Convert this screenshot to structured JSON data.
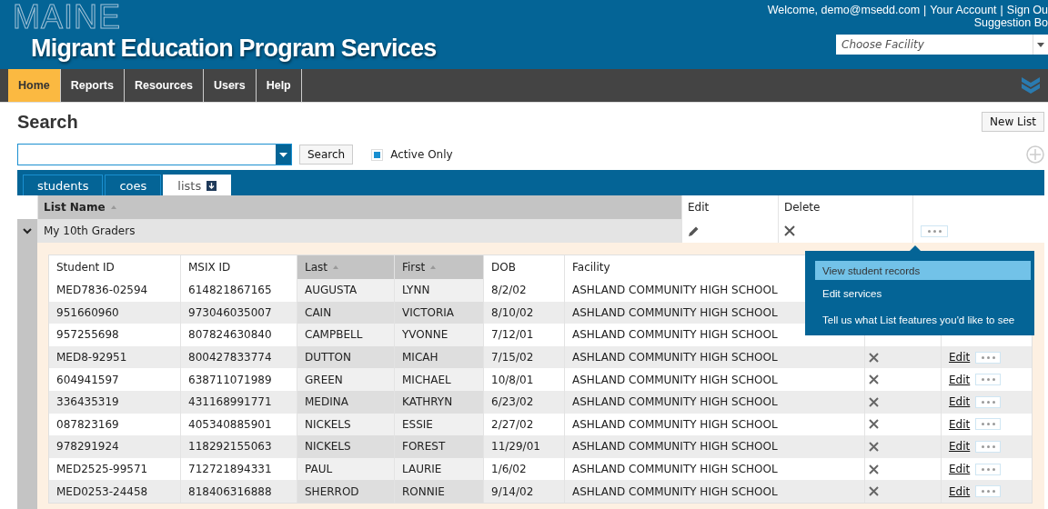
{
  "header": {
    "logo_outline": "MAINE",
    "logo_title": "Migrant Education Program Services",
    "welcome": "Welcome, demo@msedd.com",
    "links": [
      {
        "separator": "|",
        "label": "Your Account"
      },
      {
        "separator": "|",
        "label": "Sign Ou"
      }
    ],
    "suggestion": "Suggestion Bo",
    "facility": {
      "placeholder": "Choose Facility"
    }
  },
  "nav": [
    {
      "label": "Home",
      "selected": true
    },
    {
      "label": "Reports",
      "selected": false
    },
    {
      "label": "Resources",
      "selected": false
    },
    {
      "label": "Users",
      "selected": false
    },
    {
      "label": "Help",
      "selected": false
    }
  ],
  "page_title": "Search",
  "new_list": "New List",
  "search": {
    "button": "Search",
    "active_only": {
      "label": "Active Only",
      "checked": true
    }
  },
  "tabs": [
    {
      "label": "students",
      "selected": false
    },
    {
      "label": "coes",
      "selected": false
    },
    {
      "label": "lists",
      "selected": true
    }
  ],
  "lists_table": {
    "columns": [
      "List Name",
      "Edit",
      "Delete"
    ],
    "rows": [
      {
        "name": "My 10th Graders",
        "expanded": true
      }
    ]
  },
  "students": {
    "columns": [
      {
        "label": "Student ID",
        "sorted": false
      },
      {
        "label": "MSIX ID",
        "sorted": false
      },
      {
        "label": "Last",
        "sorted": true
      },
      {
        "label": "First",
        "sorted": true
      },
      {
        "label": "DOB",
        "sorted": false
      },
      {
        "label": "Facility",
        "sorted": false
      }
    ],
    "rows": [
      {
        "student_id": "MED7836-02594",
        "msix_id": "614821867165",
        "last": "AUGUSTA",
        "first": "LYNN",
        "dob": "8/2/02",
        "facility": "ASHLAND COMMUNITY HIGH SCHOOL",
        "edit": null
      },
      {
        "student_id": "951660960",
        "msix_id": "973046035007",
        "last": "CAIN",
        "first": "VICTORIA",
        "dob": "8/10/02",
        "facility": "ASHLAND COMMUNITY HIGH SCHOOL",
        "edit": null
      },
      {
        "student_id": "957255698",
        "msix_id": "807824630840",
        "last": "CAMPBELL",
        "first": "YVONNE",
        "dob": "7/12/01",
        "facility": "ASHLAND COMMUNITY HIGH SCHOOL",
        "edit": null
      },
      {
        "student_id": "MED8-92951",
        "msix_id": "800427833774",
        "last": "DUTTON",
        "first": "MICAH",
        "dob": "7/15/02",
        "facility": "ASHLAND COMMUNITY HIGH SCHOOL",
        "edit": "Edit"
      },
      {
        "student_id": "604941597",
        "msix_id": "638711071989",
        "last": "GREEN",
        "first": "MICHAEL",
        "dob": "10/8/01",
        "facility": "ASHLAND COMMUNITY HIGH SCHOOL",
        "edit": "Edit"
      },
      {
        "student_id": "336435319",
        "msix_id": "431168991771",
        "last": "MEDINA",
        "first": "KATHRYN",
        "dob": "6/23/02",
        "facility": "ASHLAND COMMUNITY HIGH SCHOOL",
        "edit": "Edit"
      },
      {
        "student_id": "087823169",
        "msix_id": "405340885901",
        "last": "NICKELS",
        "first": "ESSIE",
        "dob": "2/27/02",
        "facility": "ASHLAND COMMUNITY HIGH SCHOOL",
        "edit": "Edit"
      },
      {
        "student_id": "978291924",
        "msix_id": "118292155063",
        "last": "NICKELS",
        "first": "FOREST",
        "dob": "11/29/01",
        "facility": "ASHLAND COMMUNITY HIGH SCHOOL",
        "edit": "Edit"
      },
      {
        "student_id": "MED2525-99571",
        "msix_id": "712721894331",
        "last": "PAUL",
        "first": "LAURIE",
        "dob": "1/6/02",
        "facility": "ASHLAND COMMUNITY HIGH SCHOOL",
        "edit": "Edit"
      },
      {
        "student_id": "MED0253-24458",
        "msix_id": "818406316888",
        "last": "SHERROD",
        "first": "RONNIE",
        "dob": "9/14/02",
        "facility": "ASHLAND COMMUNITY HIGH SCHOOL",
        "edit": "Edit"
      }
    ]
  },
  "menu": [
    {
      "label": "View student records",
      "selected": true
    },
    {
      "label": "Edit services",
      "selected": false
    },
    {
      "label": "Tell us what List features you'd like to see",
      "selected": false
    }
  ]
}
